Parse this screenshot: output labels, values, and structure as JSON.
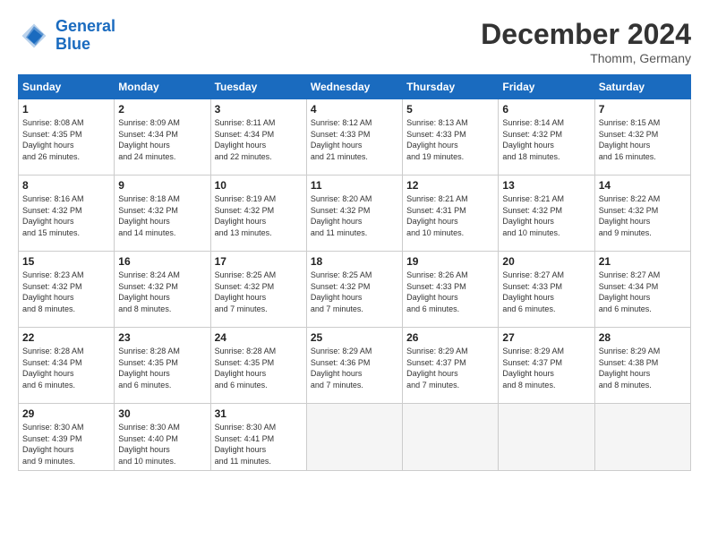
{
  "header": {
    "logo_line1": "General",
    "logo_line2": "Blue",
    "month_title": "December 2024",
    "location": "Thomm, Germany"
  },
  "weekdays": [
    "Sunday",
    "Monday",
    "Tuesday",
    "Wednesday",
    "Thursday",
    "Friday",
    "Saturday"
  ],
  "days": [
    {
      "date": "",
      "sunrise": "",
      "sunset": "",
      "daylight": ""
    },
    {
      "date": "2",
      "sunrise": "8:09 AM",
      "sunset": "4:34 PM",
      "daylight": "8 hours and 24 minutes."
    },
    {
      "date": "3",
      "sunrise": "8:11 AM",
      "sunset": "4:34 PM",
      "daylight": "8 hours and 22 minutes."
    },
    {
      "date": "4",
      "sunrise": "8:12 AM",
      "sunset": "4:33 PM",
      "daylight": "8 hours and 21 minutes."
    },
    {
      "date": "5",
      "sunrise": "8:13 AM",
      "sunset": "4:33 PM",
      "daylight": "8 hours and 19 minutes."
    },
    {
      "date": "6",
      "sunrise": "8:14 AM",
      "sunset": "4:32 PM",
      "daylight": "8 hours and 18 minutes."
    },
    {
      "date": "7",
      "sunrise": "8:15 AM",
      "sunset": "4:32 PM",
      "daylight": "8 hours and 16 minutes."
    },
    {
      "date": "1",
      "sunrise": "8:08 AM",
      "sunset": "4:35 PM",
      "daylight": "8 hours and 26 minutes."
    },
    {
      "date": "8",
      "sunrise": "8:16 AM",
      "sunset": "4:32 PM",
      "daylight": "8 hours and 15 minutes."
    },
    {
      "date": "9",
      "sunrise": "8:18 AM",
      "sunset": "4:32 PM",
      "daylight": "8 hours and 14 minutes."
    },
    {
      "date": "10",
      "sunrise": "8:19 AM",
      "sunset": "4:32 PM",
      "daylight": "8 hours and 13 minutes."
    },
    {
      "date": "11",
      "sunrise": "8:20 AM",
      "sunset": "4:32 PM",
      "daylight": "8 hours and 11 minutes."
    },
    {
      "date": "12",
      "sunrise": "8:21 AM",
      "sunset": "4:31 PM",
      "daylight": "8 hours and 10 minutes."
    },
    {
      "date": "13",
      "sunrise": "8:21 AM",
      "sunset": "4:32 PM",
      "daylight": "8 hours and 10 minutes."
    },
    {
      "date": "14",
      "sunrise": "8:22 AM",
      "sunset": "4:32 PM",
      "daylight": "8 hours and 9 minutes."
    },
    {
      "date": "15",
      "sunrise": "8:23 AM",
      "sunset": "4:32 PM",
      "daylight": "8 hours and 8 minutes."
    },
    {
      "date": "16",
      "sunrise": "8:24 AM",
      "sunset": "4:32 PM",
      "daylight": "8 hours and 8 minutes."
    },
    {
      "date": "17",
      "sunrise": "8:25 AM",
      "sunset": "4:32 PM",
      "daylight": "8 hours and 7 minutes."
    },
    {
      "date": "18",
      "sunrise": "8:25 AM",
      "sunset": "4:32 PM",
      "daylight": "8 hours and 7 minutes."
    },
    {
      "date": "19",
      "sunrise": "8:26 AM",
      "sunset": "4:33 PM",
      "daylight": "8 hours and 6 minutes."
    },
    {
      "date": "20",
      "sunrise": "8:27 AM",
      "sunset": "4:33 PM",
      "daylight": "8 hours and 6 minutes."
    },
    {
      "date": "21",
      "sunrise": "8:27 AM",
      "sunset": "4:34 PM",
      "daylight": "8 hours and 6 minutes."
    },
    {
      "date": "22",
      "sunrise": "8:28 AM",
      "sunset": "4:34 PM",
      "daylight": "8 hours and 6 minutes."
    },
    {
      "date": "23",
      "sunrise": "8:28 AM",
      "sunset": "4:35 PM",
      "daylight": "8 hours and 6 minutes."
    },
    {
      "date": "24",
      "sunrise": "8:28 AM",
      "sunset": "4:35 PM",
      "daylight": "8 hours and 6 minutes."
    },
    {
      "date": "25",
      "sunrise": "8:29 AM",
      "sunset": "4:36 PM",
      "daylight": "8 hours and 7 minutes."
    },
    {
      "date": "26",
      "sunrise": "8:29 AM",
      "sunset": "4:37 PM",
      "daylight": "8 hours and 7 minutes."
    },
    {
      "date": "27",
      "sunrise": "8:29 AM",
      "sunset": "4:37 PM",
      "daylight": "8 hours and 8 minutes."
    },
    {
      "date": "28",
      "sunrise": "8:29 AM",
      "sunset": "4:38 PM",
      "daylight": "8 hours and 8 minutes."
    },
    {
      "date": "29",
      "sunrise": "8:30 AM",
      "sunset": "4:39 PM",
      "daylight": "8 hours and 9 minutes."
    },
    {
      "date": "30",
      "sunrise": "8:30 AM",
      "sunset": "4:40 PM",
      "daylight": "8 hours and 10 minutes."
    },
    {
      "date": "31",
      "sunrise": "8:30 AM",
      "sunset": "4:41 PM",
      "daylight": "8 hours and 11 minutes."
    }
  ],
  "labels": {
    "sunrise": "Sunrise:",
    "sunset": "Sunset:",
    "daylight": "Daylight:"
  }
}
